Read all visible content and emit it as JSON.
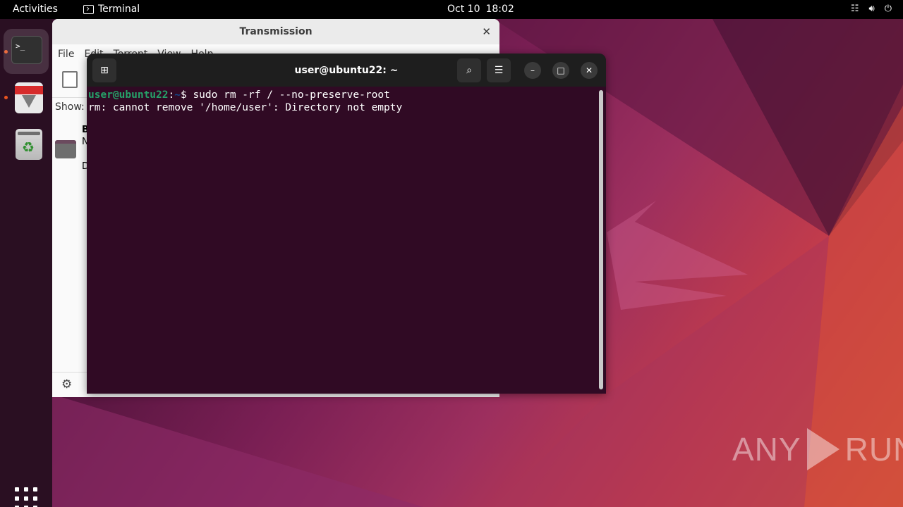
{
  "topbar": {
    "activities": "Activities",
    "app_name": "Terminal",
    "date": "Oct 10",
    "time": "18:02",
    "tray_icons": [
      "network-icon",
      "volume-icon",
      "power-icon"
    ]
  },
  "dock": {
    "items": [
      {
        "name": "Terminal",
        "icon": "terminal-icon",
        "active": true
      },
      {
        "name": "Transmission",
        "icon": "transmission-icon",
        "active": false
      },
      {
        "name": "Trash",
        "icon": "trash-icon",
        "active": false
      }
    ],
    "show_apps_icon": "apps-grid-icon",
    "terminal_glyph": ">_"
  },
  "transmission": {
    "title": "Transmission",
    "menu": [
      "File",
      "Edit",
      "Torrent",
      "View",
      "Help"
    ],
    "show_label": "Show:",
    "row": {
      "line1": "B",
      "line2": "N",
      "line3": "D"
    }
  },
  "terminal": {
    "title": "user@ubuntu22: ~",
    "prompt_user": "user@ubuntu22",
    "prompt_sep": ":",
    "prompt_path": "~",
    "prompt_end": "$ ",
    "command": "sudo rm -rf / --no-preserve-root",
    "output": "rm: cannot remove '/home/user': Directory not empty"
  },
  "watermark": {
    "left": "ANY",
    "right": "RUN"
  }
}
